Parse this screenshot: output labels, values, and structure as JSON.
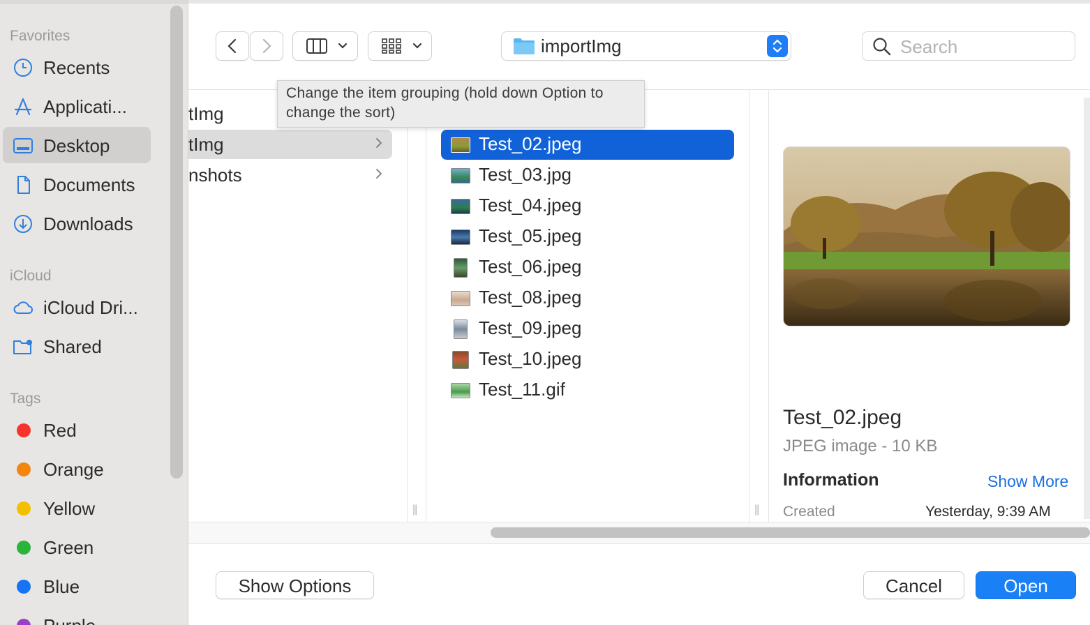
{
  "sidebar": {
    "favorites_heading": "Favorites",
    "favorites": [
      {
        "label": "Recents",
        "icon": "clock-icon"
      },
      {
        "label": "Applicati...",
        "icon": "applications-icon"
      },
      {
        "label": "Desktop",
        "icon": "desktop-icon",
        "selected": true
      },
      {
        "label": "Documents",
        "icon": "document-icon"
      },
      {
        "label": "Downloads",
        "icon": "download-icon"
      }
    ],
    "icloud_heading": "iCloud",
    "icloud": [
      {
        "label": "iCloud Dri...",
        "icon": "cloud-icon"
      },
      {
        "label": "Shared",
        "icon": "shared-folder-icon"
      }
    ],
    "tags_heading": "Tags",
    "tags": [
      {
        "label": "Red",
        "color": "#f5352d"
      },
      {
        "label": "Orange",
        "color": "#f3860f"
      },
      {
        "label": "Yellow",
        "color": "#f2c000"
      },
      {
        "label": "Green",
        "color": "#2bb43a"
      },
      {
        "label": "Blue",
        "color": "#1673f2"
      },
      {
        "label": "Purple",
        "color": "#9a3fc8"
      }
    ]
  },
  "toolbar": {
    "location": "importImg",
    "search_placeholder": "Search"
  },
  "tooltip": {
    "line1": "Change the item grouping (hold down Option to",
    "line2": "change the sort)"
  },
  "column1": [
    {
      "label": "tImg",
      "has_children": false
    },
    {
      "label": "tImg",
      "has_children": true,
      "highlighted": true
    },
    {
      "label": "nshots",
      "has_children": true
    }
  ],
  "files": [
    {
      "name": "Test_02.jpeg",
      "selected": true
    },
    {
      "name": "Test_03.jpg"
    },
    {
      "name": "Test_04.jpeg"
    },
    {
      "name": "Test_05.jpeg"
    },
    {
      "name": "Test_06.jpeg"
    },
    {
      "name": "Test_08.jpeg"
    },
    {
      "name": "Test_09.jpeg"
    },
    {
      "name": "Test_10.jpeg"
    },
    {
      "name": "Test_11.gif"
    }
  ],
  "preview": {
    "name": "Test_02.jpeg",
    "kind": "JPEG image - 10 KB",
    "info_heading": "Information",
    "show_more": "Show More",
    "created_label": "Created",
    "created_value": "Yesterday, 9:39 AM"
  },
  "footer": {
    "show_options": "Show Options",
    "cancel": "Cancel",
    "open": "Open"
  },
  "colors": {
    "accent": "#1a80f5",
    "selection": "#1162d9",
    "sidebar_icon": "#2f7fe0"
  }
}
